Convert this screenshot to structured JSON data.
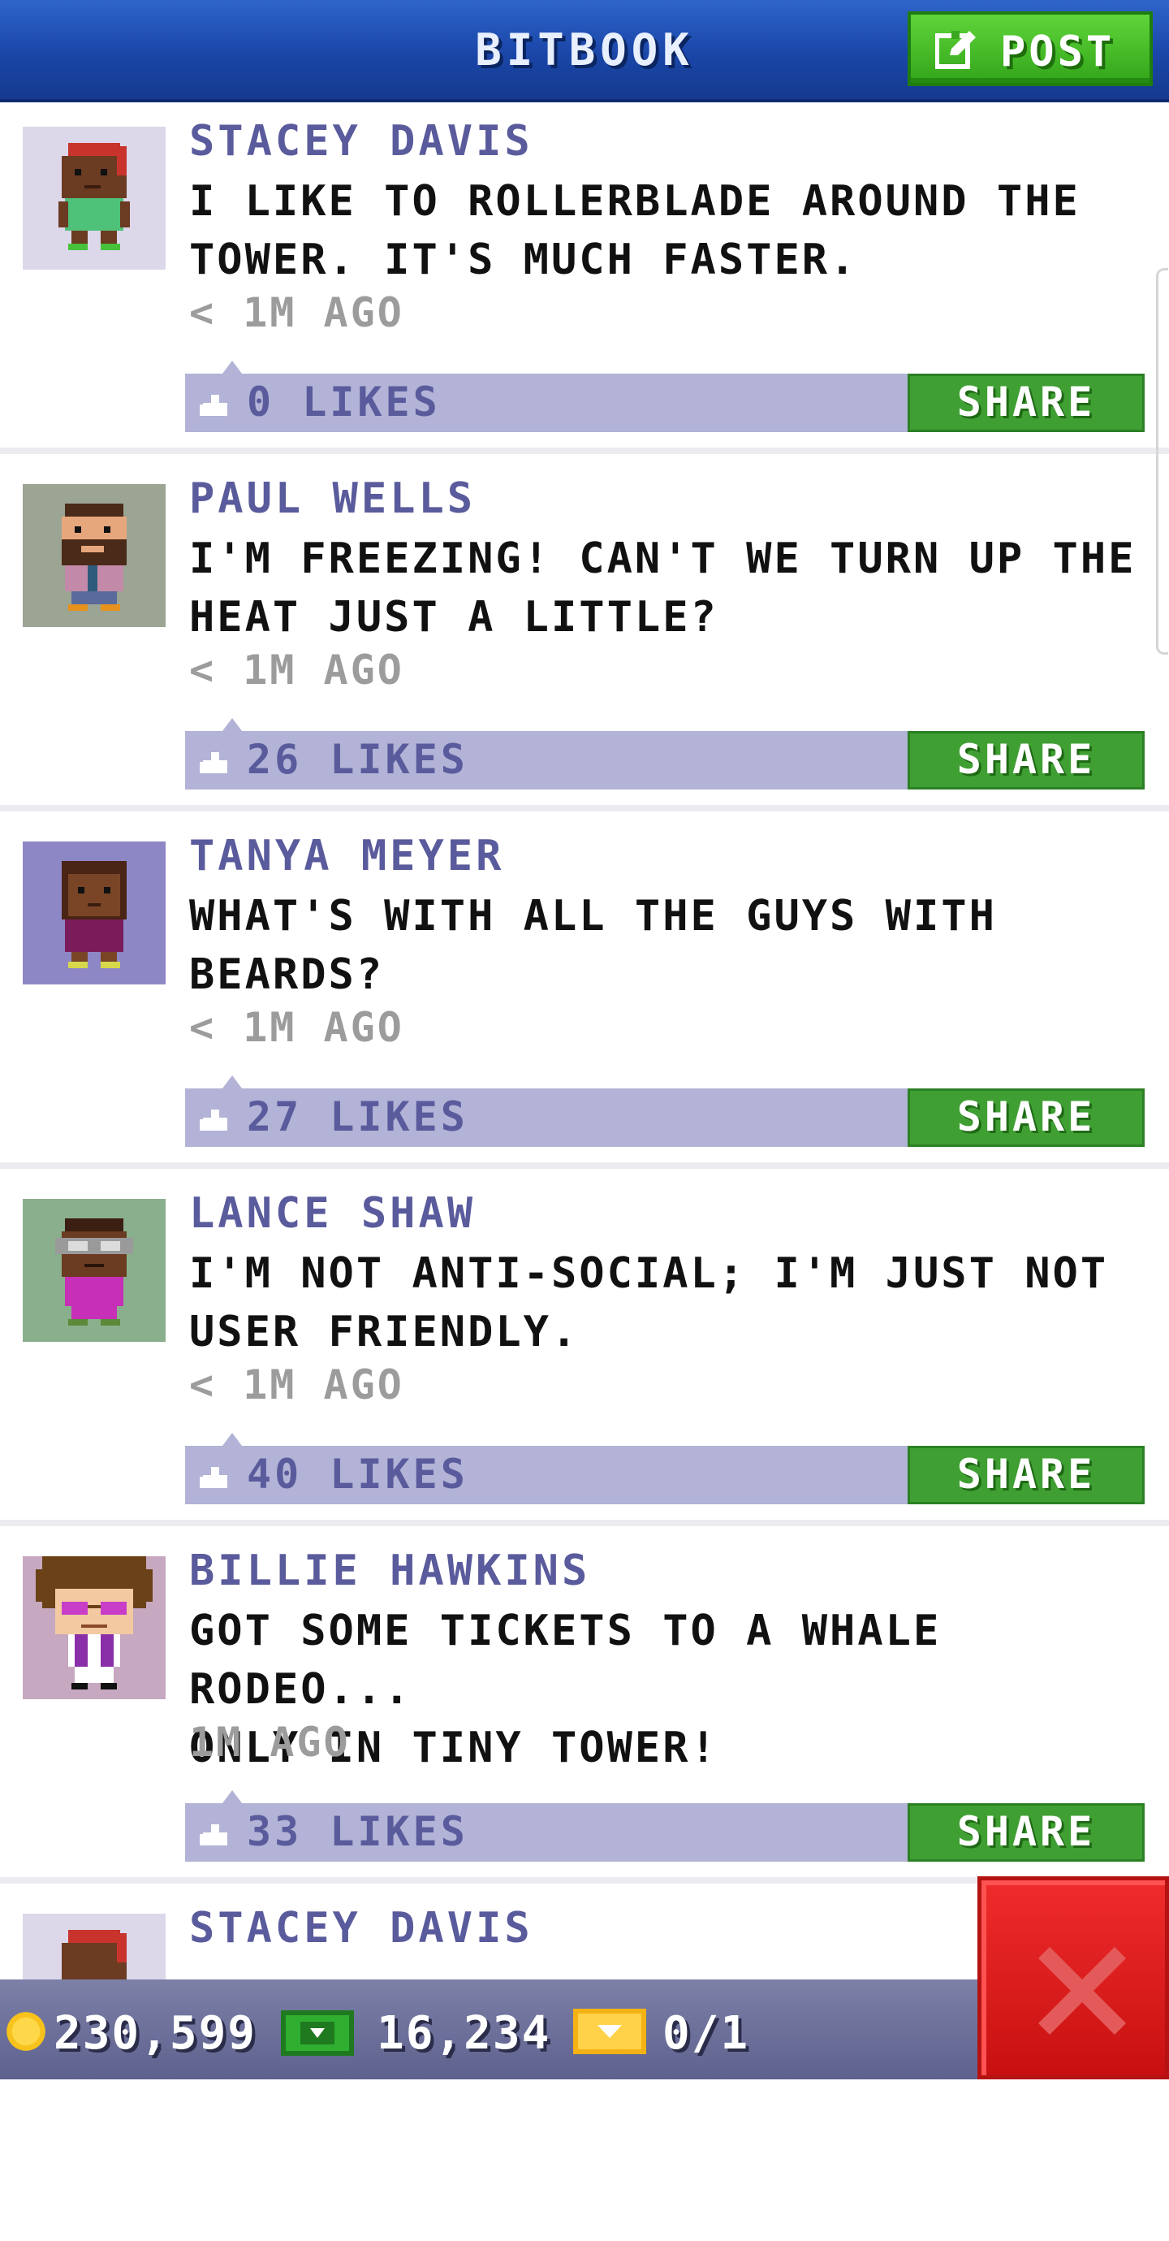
{
  "header": {
    "title": "BITBOOK",
    "post_label": "POST"
  },
  "posts": [
    {
      "author": "STACEY DAVIS",
      "message": "I LIKE TO ROLLERBLADE AROUND THE\nTOWER. IT'S MUCH FASTER.",
      "time": "< 1M AGO",
      "likes": "0 LIKES",
      "share_label": "SHARE",
      "avatar_icon": "stacey-avatar-icon",
      "avatar_bg": "#dcd8ea"
    },
    {
      "author": "PAUL WELLS",
      "message": "I'M FREEZING! CAN'T WE TURN UP THE\nHEAT JUST A LITTLE?",
      "time": "< 1M AGO",
      "likes": "26 LIKES",
      "share_label": "SHARE",
      "avatar_icon": "paul-avatar-icon",
      "avatar_bg": "#9ca493"
    },
    {
      "author": "TANYA MEYER",
      "message": "WHAT'S WITH ALL THE GUYS WITH\nBEARDS?",
      "time": "< 1M AGO",
      "likes": "27 LIKES",
      "share_label": "SHARE",
      "avatar_icon": "tanya-avatar-icon",
      "avatar_bg": "#8e87c6"
    },
    {
      "author": "LANCE SHAW",
      "message": "I'M NOT ANTI-SOCIAL; I'M JUST NOT\nUSER FRIENDLY.",
      "time": "< 1M AGO",
      "likes": "40 LIKES",
      "share_label": "SHARE",
      "avatar_icon": "lance-avatar-icon",
      "avatar_bg": "#8aaf8c"
    },
    {
      "author": "BILLIE HAWKINS",
      "message": "GOT SOME TICKETS TO A WHALE RODEO...\nONLY IN TINY TOWER!",
      "time": "1M AGO",
      "likes": "33 LIKES",
      "share_label": "SHARE",
      "avatar_icon": "billie-avatar-icon",
      "avatar_bg": "#c6a8c0"
    },
    {
      "author": "STACEY DAVIS",
      "message": "",
      "time": "",
      "likes": "",
      "share_label": "",
      "avatar_icon": "stacey-avatar-icon",
      "avatar_bg": "#dcd8ea"
    }
  ],
  "status_bar": {
    "coins": "230,599",
    "bux": "16,234",
    "tickets": "0/1",
    "coin_icon": "coin-icon",
    "bux_icon": "bux-icon",
    "ticket_icon": "ticket-icon"
  },
  "colors": {
    "header_blue": "#1a46a8",
    "post_green": "#3fc21f",
    "share_green": "#3f9f33",
    "author_purple": "#5a5b9c",
    "likes_bar": "#b2b3d6",
    "close_red": "#e02020"
  }
}
